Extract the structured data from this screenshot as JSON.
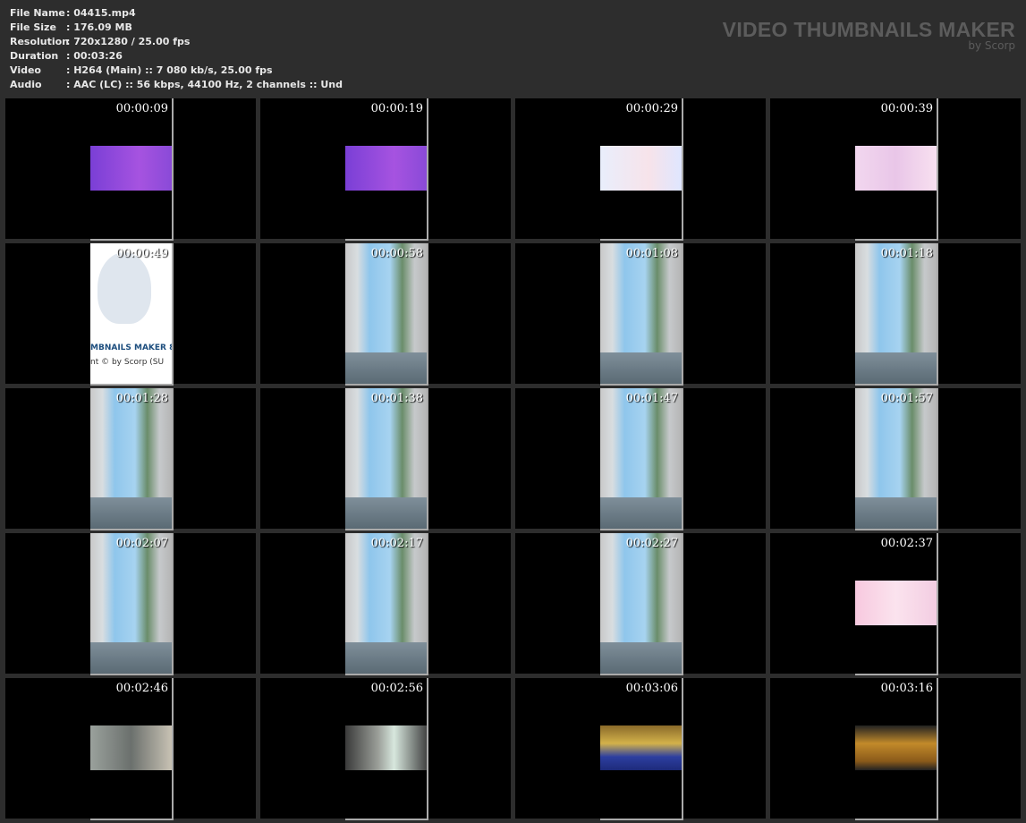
{
  "info": [
    {
      "label": "File Name",
      "value": ": 04415.mp4"
    },
    {
      "label": "File Size",
      "value": ": 176.09 MB"
    },
    {
      "label": "Resolution",
      "value": ": 720x1280 / 25.00 fps"
    },
    {
      "label": "Duration",
      "value": ": 00:03:26"
    },
    {
      "label": "Video",
      "value": ": H264 (Main) :: 7 080 kb/s, 25.00 fps"
    },
    {
      "label": "Audio",
      "value": ": AAC (LC) :: 56 kbps, 44100 Hz, 2 channels :: Und"
    }
  ],
  "brand": {
    "title": "VIDEO THUMBNAILS MAKER",
    "subtitle": "by Scorp"
  },
  "owl": {
    "line1": "MBNAILS MAKER 8",
    "line2": "nt © by Scorp (SU"
  },
  "thumbnails": [
    {
      "time": "00:00:09",
      "kind": "b-purple"
    },
    {
      "time": "00:00:19",
      "kind": "b-purple"
    },
    {
      "time": "00:00:29",
      "kind": "b-anime"
    },
    {
      "time": "00:00:39",
      "kind": "b-pink"
    },
    {
      "time": "00:00:49",
      "kind": "p-owl"
    },
    {
      "time": "00:00:58",
      "kind": "p-room"
    },
    {
      "time": "00:01:08",
      "kind": "p-room"
    },
    {
      "time": "00:01:18",
      "kind": "p-room"
    },
    {
      "time": "00:01:28",
      "kind": "p-room"
    },
    {
      "time": "00:01:38",
      "kind": "p-room"
    },
    {
      "time": "00:01:47",
      "kind": "p-room"
    },
    {
      "time": "00:01:57",
      "kind": "p-room"
    },
    {
      "time": "00:02:07",
      "kind": "p-room"
    },
    {
      "time": "00:02:17",
      "kind": "p-room"
    },
    {
      "time": "00:02:27",
      "kind": "p-room"
    },
    {
      "time": "00:02:37",
      "kind": "b-pink2"
    },
    {
      "time": "00:02:46",
      "kind": "b-grey"
    },
    {
      "time": "00:02:56",
      "kind": "b-room"
    },
    {
      "time": "00:03:06",
      "kind": "b-bottles"
    },
    {
      "time": "00:03:16",
      "kind": "b-bottles2"
    }
  ]
}
